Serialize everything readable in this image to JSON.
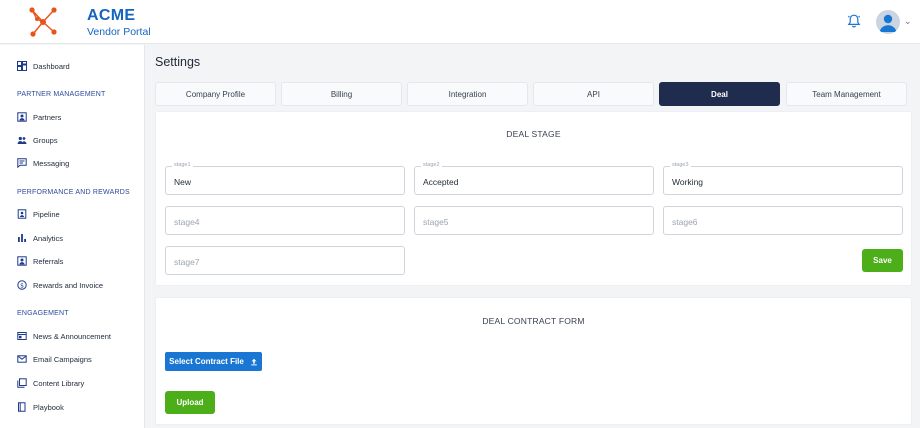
{
  "brand": {
    "title": "ACME",
    "subtitle": "Vendor Portal",
    "logo_icon": "network-logo-icon",
    "accent": "#1565c0"
  },
  "header": {
    "notification_icon": "bell-icon",
    "avatar_icon": "user-avatar-icon",
    "menu_icon": "chevron-down-icon"
  },
  "sidebar": {
    "dashboard": "Dashboard",
    "sections": {
      "partner_management": "PARTNER MANAGEMENT",
      "performance": "PERFORMANCE AND REWARDS",
      "engagement": "ENGAGEMENT"
    },
    "items": {
      "partners": "Partners",
      "groups": "Groups",
      "messaging": "Messaging",
      "pipeline": "Pipeline",
      "analytics": "Analytics",
      "referrals": "Referrals",
      "rewards": "Rewards and Invoice",
      "news": "News & Announcement",
      "email": "Email Campaigns",
      "content": "Content Library",
      "playbook": "Playbook"
    }
  },
  "page": {
    "title": "Settings"
  },
  "tabs": [
    "Company Profile",
    "Billing",
    "Integration",
    "API",
    "Deal",
    "Team Management"
  ],
  "active_tab": "Deal",
  "deal_stage": {
    "title": "DEAL STAGE",
    "stages": [
      {
        "label": "stage1",
        "value": "New"
      },
      {
        "label": "stage2",
        "value": "Accepted"
      },
      {
        "label": "stage3",
        "value": "Working"
      },
      {
        "label": "",
        "placeholder": "stage4"
      },
      {
        "label": "",
        "placeholder": "stage5"
      },
      {
        "label": "",
        "placeholder": "stage6"
      },
      {
        "label": "",
        "placeholder": "stage7"
      }
    ],
    "save_label": "Save"
  },
  "contract_form": {
    "title": "DEAL CONTRACT FORM",
    "select_label": "Select Contract File",
    "select_icon": "upload-icon",
    "upload_label": "Upload"
  },
  "colors": {
    "primary_dark": "#1f2c4d",
    "green": "#4caf1a",
    "blue": "#1976d2",
    "orange": "#e8531a"
  }
}
